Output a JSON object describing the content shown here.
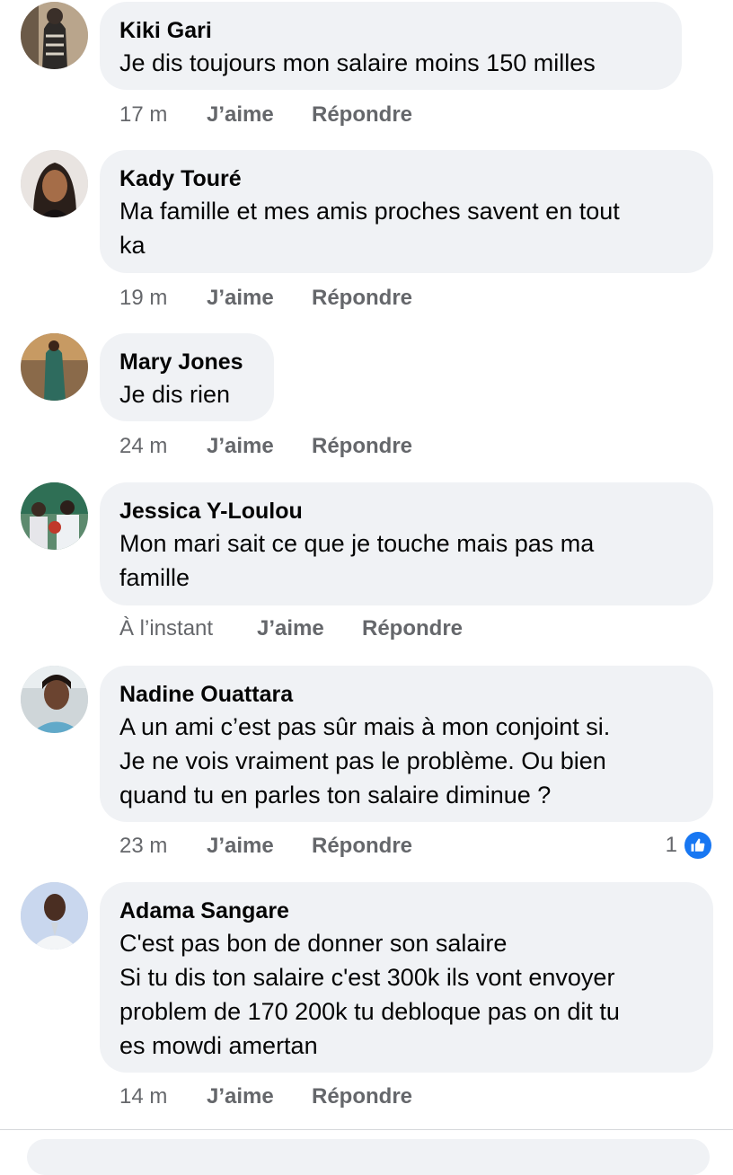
{
  "comments": [
    {
      "author": "Kiki Gari",
      "lines": [
        "Je dis toujours mon salaire moins 150 milles"
      ],
      "time": "17 m",
      "like": "J’aime",
      "reply": "Répondre"
    },
    {
      "author": "Kady Touré",
      "lines": [
        "Ma famille et mes amis proches savent en tout",
        "ka"
      ],
      "time": "19 m",
      "like": "J’aime",
      "reply": "Répondre"
    },
    {
      "author": "Mary Jones",
      "lines": [
        "Je dis rien"
      ],
      "time": "24 m",
      "like": "J’aime",
      "reply": "Répondre"
    },
    {
      "author": "Jessica Y-Loulou",
      "lines": [
        "Mon mari sait ce que je touche mais pas ma",
        "famille"
      ],
      "time": "À l’instant",
      "like": "J’aime",
      "reply": "Répondre"
    },
    {
      "author": "Nadine Ouattara",
      "lines": [
        "A un ami c’est pas sûr mais à mon conjoint si.",
        "Je ne vois vraiment pas le problème. Ou bien",
        "quand tu en parles ton salaire diminue ?"
      ],
      "time": "23 m",
      "like": "J’aime",
      "reply": "Répondre",
      "reaction_count": "1",
      "reaction_icon": "thumbs-up-icon"
    },
    {
      "author": "Adama Sangare",
      "lines": [
        "C'est pas bon de donner son salaire",
        "Si tu dis ton salaire c'est 300k ils vont envoyer",
        "problem de 170 200k tu debloque pas on dit tu",
        "es mowdi amertan"
      ],
      "time": "14 m",
      "like": "J’aime",
      "reply": "Répondre"
    }
  ],
  "colors": {
    "bubble_bg": "#f0f2f5",
    "meta_text": "#65676b",
    "like_badge": "#1877f2"
  }
}
